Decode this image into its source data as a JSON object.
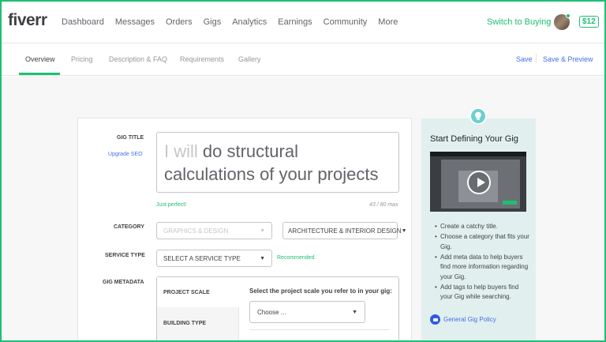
{
  "nav": {
    "logo": "fiverr",
    "links": [
      "Dashboard",
      "Messages",
      "Orders",
      "Gigs",
      "Analytics",
      "Earnings",
      "Community",
      "More"
    ],
    "switch_label": "Switch to Buying",
    "balance": "$12"
  },
  "subnav": {
    "tabs": [
      "Overview",
      "Pricing",
      "Description & FAQ",
      "Requirements",
      "Gallery"
    ],
    "active_tab": "Overview",
    "save_label": "Save",
    "save_preview_label": "Save & Preview"
  },
  "form": {
    "gig_title_label": "GIG TITLE",
    "upgrade_seo": "Upgrade SEO",
    "title_prefix": "I will",
    "title_value": "do structural calculations of your projects",
    "title_status": "Just perfect!",
    "title_counter": "43 / 80 max",
    "category_label": "CATEGORY",
    "category_value": "GRAPHICS & DESIGN",
    "subcategory_value": "ARCHITECTURE & INTERIOR DESIGN",
    "service_type_label": "SERVICE TYPE",
    "service_type_placeholder": "SELECT A SERVICE TYPE",
    "recommended": "Recommended",
    "metadata_label": "GIG METADATA",
    "metadata_items": [
      "PROJECT SCALE",
      "BUILDING TYPE"
    ],
    "metadata_question": "Select the project scale you refer to in your gig:",
    "metadata_choose": "Choose ..."
  },
  "guide": {
    "title": "Start Defining Your Gig",
    "tips": [
      "Create a catchy title.",
      "Choose a category that fits your Gig.",
      "Add meta data to help buyers find more information regarding your Gig.",
      "Add tags to help buyers find your Gig while searching."
    ],
    "policy_link": "General Gig Policy"
  },
  "colors": {
    "brand_green": "#1dbf73",
    "link_blue": "#446ee7",
    "guide_bg": "#e1f0ef"
  }
}
